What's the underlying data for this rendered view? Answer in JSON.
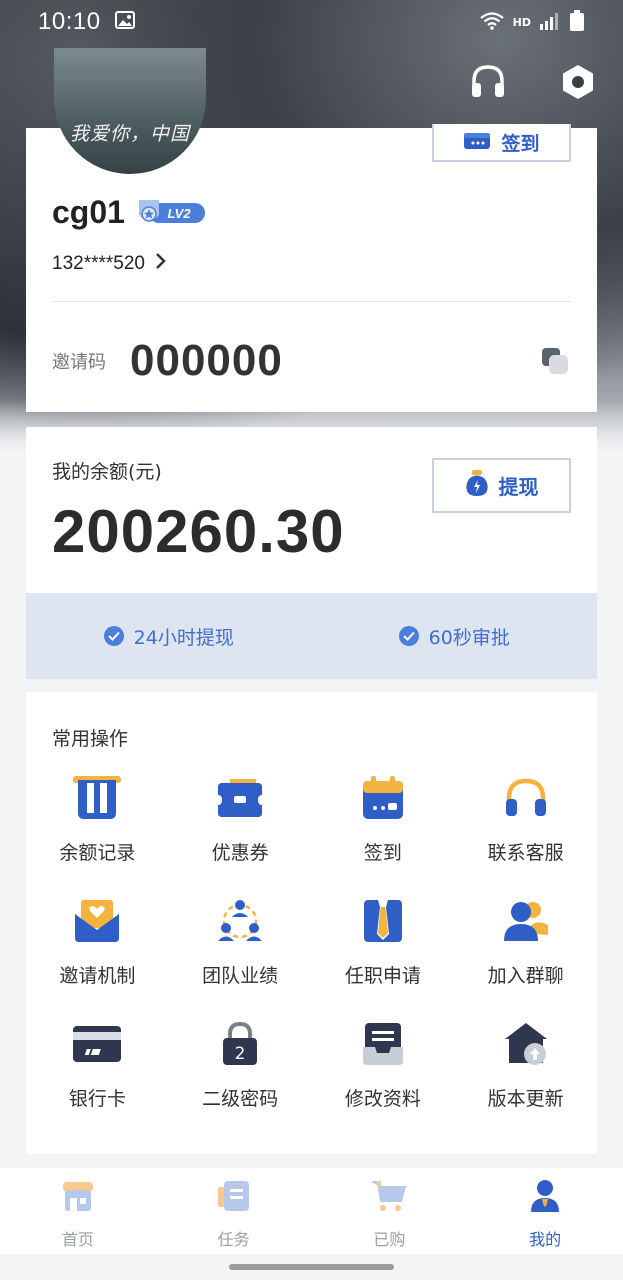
{
  "status_bar": {
    "time": "10:10",
    "network": "HD"
  },
  "profile": {
    "avatar_text": "我爱你，中国",
    "checkin_label": "签到",
    "username": "cg01",
    "level": "LV2",
    "phone": "132****520",
    "invite_label": "邀请码",
    "invite_code": "000000"
  },
  "balance": {
    "label": "我的余额(元)",
    "amount": "200260.30",
    "withdraw_label": "提现",
    "features": [
      "24小时提现",
      "60秒审批"
    ]
  },
  "ops": {
    "title": "常用操作",
    "items": [
      {
        "label": "余额记录",
        "icon": "balance-record-icon"
      },
      {
        "label": "优惠券",
        "icon": "coupon-icon"
      },
      {
        "label": "签到",
        "icon": "calendar-icon"
      },
      {
        "label": "联系客服",
        "icon": "headset-icon"
      },
      {
        "label": "邀请机制",
        "icon": "invite-envelope-icon"
      },
      {
        "label": "团队业绩",
        "icon": "team-icon"
      },
      {
        "label": "任职申请",
        "icon": "tie-icon"
      },
      {
        "label": "加入群聊",
        "icon": "group-chat-icon"
      },
      {
        "label": "银行卡",
        "icon": "bank-card-icon"
      },
      {
        "label": "二级密码",
        "icon": "lock-icon"
      },
      {
        "label": "修改资料",
        "icon": "edit-profile-icon"
      },
      {
        "label": "版本更新",
        "icon": "update-icon"
      }
    ]
  },
  "nav": {
    "items": [
      {
        "label": "首页",
        "icon": "home-icon",
        "active": false
      },
      {
        "label": "任务",
        "icon": "task-icon",
        "active": false
      },
      {
        "label": "已购",
        "icon": "cart-icon",
        "active": false
      },
      {
        "label": "我的",
        "icon": "profile-icon",
        "active": true
      }
    ]
  },
  "colors": {
    "accent": "#2f5fc6",
    "accent_light": "#4b7fdc",
    "strip_bg": "#dfe5f0",
    "gold": "#f4b23f"
  }
}
